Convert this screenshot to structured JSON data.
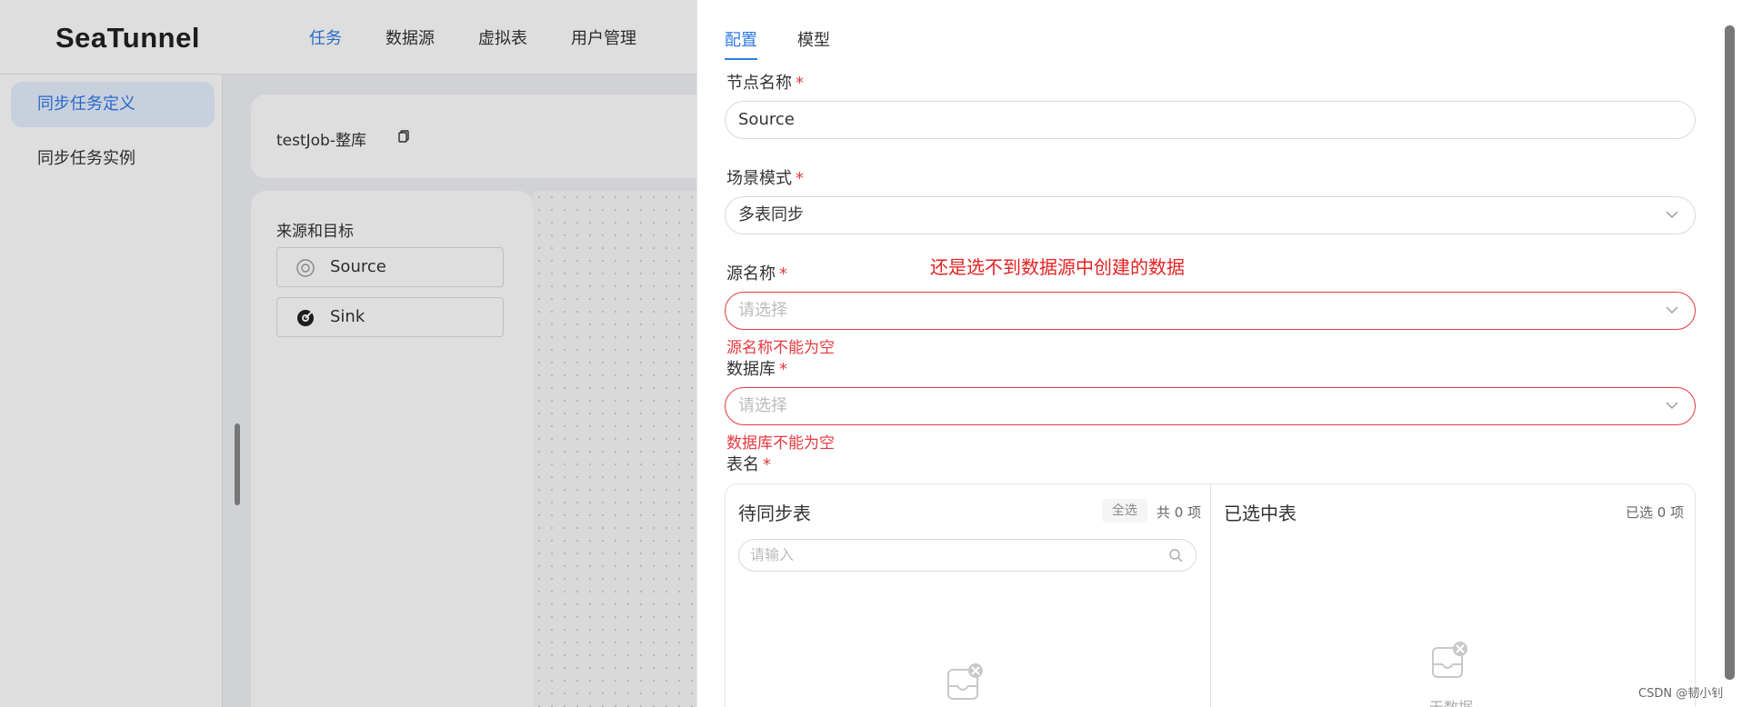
{
  "app": {
    "logo": "SeaTunnel"
  },
  "nav": [
    "任务",
    "数据源",
    "虚拟表",
    "用户管理"
  ],
  "sidebar": [
    "同步任务定义",
    "同步任务实例"
  ],
  "job": {
    "title": "testJob-整库"
  },
  "canvas": {
    "title": "来源和目标",
    "nodes": [
      "Source",
      "Sink"
    ]
  },
  "drawer": {
    "tabs": [
      "配置",
      "模型"
    ],
    "node_name": {
      "label": "节点名称",
      "value": "Source"
    },
    "scene_mode": {
      "label": "场景模式",
      "value": "多表同步"
    },
    "source_name": {
      "label": "源名称",
      "placeholder": "请选择",
      "error": "源名称不能为空"
    },
    "database": {
      "label": "数据库",
      "placeholder": "请选择",
      "error": "数据库不能为空"
    },
    "table_name": {
      "label": "表名"
    },
    "required_mark": "*",
    "annotation": "还是选不到数据源中创建的数据",
    "transfer": {
      "left_title": "待同步表",
      "select_all": "全选",
      "left_count": "共 0 项",
      "search_placeholder": "请输入",
      "right_title": "已选中表",
      "right_count": "已选 0 项",
      "empty_text": "无数据"
    }
  },
  "watermark": "CSDN @韧小钊",
  "colors": {
    "primary": "#2f7ae5",
    "error": "#e6393f"
  }
}
